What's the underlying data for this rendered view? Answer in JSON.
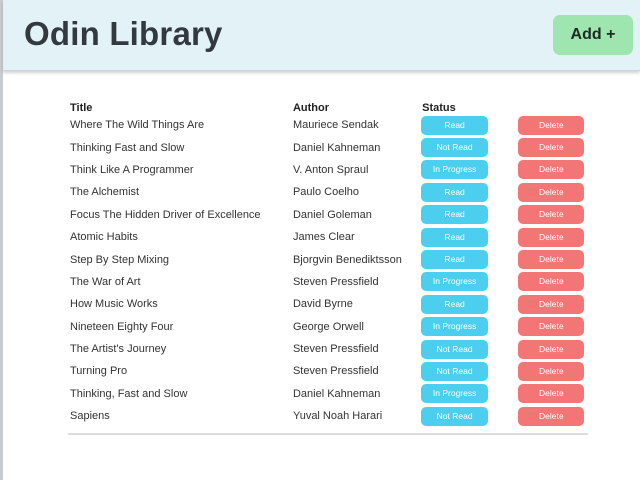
{
  "header": {
    "title": "Odin Library",
    "add_button_label": "Add +"
  },
  "table": {
    "columns": [
      "Title",
      "Author",
      "Status",
      ""
    ],
    "rows": [
      {
        "title": "Where The Wild Things Are",
        "author": "Mauriece Sendak",
        "status": "Read",
        "action": "Delete"
      },
      {
        "title": "Thinking Fast and Slow",
        "author": "Daniel Kahneman",
        "status": "Not Read",
        "action": "Delete"
      },
      {
        "title": "Think Like A Programmer",
        "author": "V. Anton Spraul",
        "status": "In Progress",
        "action": "Delete"
      },
      {
        "title": "The Alchemist",
        "author": "Paulo Coelho",
        "status": "Read",
        "action": "Delete"
      },
      {
        "title": "Focus The Hidden Driver of Excellence",
        "author": "Daniel Goleman",
        "status": "Read",
        "action": "Delete"
      },
      {
        "title": "Atomic Habits",
        "author": "James Clear",
        "status": "Read",
        "action": "Delete"
      },
      {
        "title": "Step By Step Mixing",
        "author": "Bjorgvin Benediktsson",
        "status": "Read",
        "action": "Delete"
      },
      {
        "title": "The War of Art",
        "author": "Steven Pressfield",
        "status": "In Progress",
        "action": "Delete"
      },
      {
        "title": "How Music Works",
        "author": "David Byrne",
        "status": "Read",
        "action": "Delete"
      },
      {
        "title": "Nineteen Eighty Four",
        "author": "George Orwell",
        "status": "In Progress",
        "action": "Delete"
      },
      {
        "title": "The Artist's Journey",
        "author": "Steven Pressfield",
        "status": "Not Read",
        "action": "Delete"
      },
      {
        "title": "Turning Pro",
        "author": "Steven Pressfield",
        "status": "Not Read",
        "action": "Delete"
      },
      {
        "title": "Thinking, Fast and Slow",
        "author": "Daniel Kahneman",
        "status": "In Progress",
        "action": "Delete"
      },
      {
        "title": "Sapiens",
        "author": "Yuval Noah Harari",
        "status": "Not Read",
        "action": "Delete"
      }
    ]
  },
  "colors": {
    "header_bg": "#e2f2f7",
    "add_button": "#9ee5b0",
    "status_button": "#4ccfef",
    "delete_button": "#f27676"
  }
}
